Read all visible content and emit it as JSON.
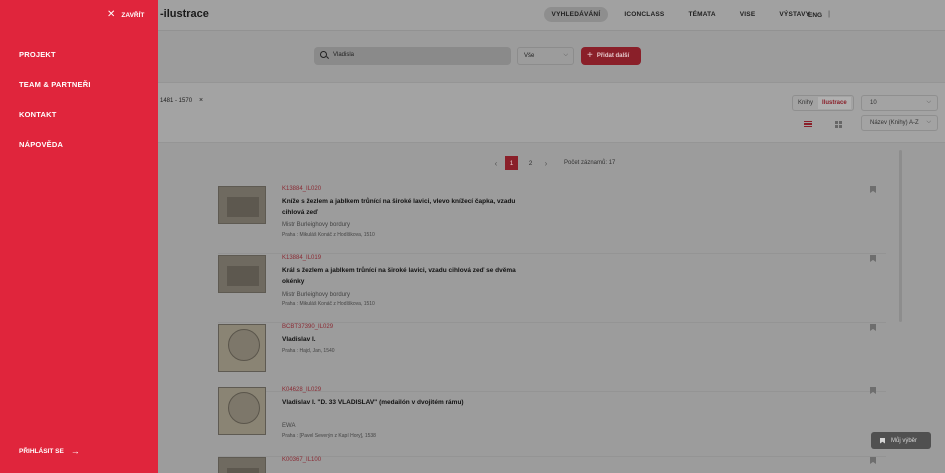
{
  "header": {
    "title": "-ilustrace",
    "nav": [
      "VYHLEDÁVÁNÍ",
      "ICONCLASS",
      "TÉMATA",
      "VISE",
      "VÝSTAVY"
    ],
    "separator": "|",
    "lang": "ENG"
  },
  "search": {
    "value": "Vladisla",
    "scope": "Vše",
    "add_label": "Přidat další",
    "filter_chip": "1481 - 1570"
  },
  "view": {
    "toggle": [
      "Knihy",
      "Ilustrace"
    ],
    "per_page": "10",
    "sort": "Název (Knihy) A-Z"
  },
  "pagination": {
    "pages": [
      "1",
      "2"
    ],
    "current": "1",
    "count_label": "Počet záznamů: 17"
  },
  "results": [
    {
      "code": "K13884_IL020",
      "title": "Kníže s žezlem a jablkem trůnící na široké lavici, vlevo knížecí čapka, vzadu cihlová zeď",
      "author": "Mistr Burleighovy bordury",
      "publication": "Praha : Mikuláš Konáč z Hodíškova, 1510"
    },
    {
      "code": "K13884_IL019",
      "title": "Král s žezlem a jablkem trůnící na široké lavici, vzadu cihlová zeď se dvěma okénky",
      "author": "Mistr Burleighovy bordury",
      "publication": "Praha : Mikuláš Konáč z Hodíškova, 1510"
    },
    {
      "code": "BCBT37390_IL029",
      "title": "Vladislav I.",
      "author": "",
      "publication": "Praha : Hajd, Jan, 1540"
    },
    {
      "code": "K04628_IL029",
      "title": "Vladislav I. \"D. 33 VLADISLAV\" (medailón v dvojitém rámu)",
      "author": "EWA",
      "publication": "Praha : [Pavel Severýn z Kapí Hory], 1538"
    },
    {
      "code": "K00367_IL100",
      "title": "",
      "author": "",
      "publication": ""
    }
  ],
  "my_selection": "Můj výběr",
  "drawer": {
    "close_label": "ZAVŘÍT",
    "items": [
      "PROJEKT",
      "TEAM & PARTNEŘI",
      "KONTAKT",
      "NÁPOVĚDA"
    ],
    "login_label": "PŘIHLÁSIT SE"
  },
  "colors": {
    "drawer_bg": "#e0253c",
    "accent": "#8a1f29"
  }
}
